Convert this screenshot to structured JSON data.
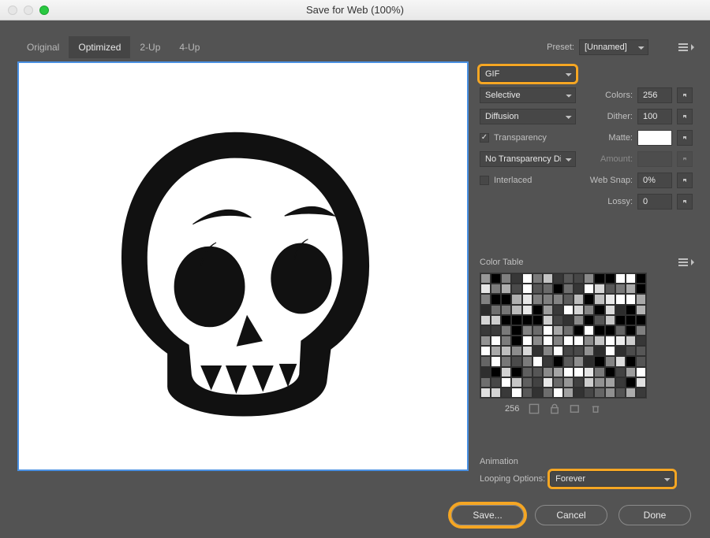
{
  "window": {
    "title": "Save for Web (100%)"
  },
  "tabs": [
    "Original",
    "Optimized",
    "2-Up",
    "4-Up"
  ],
  "active_tab": 1,
  "preset": {
    "label": "Preset:",
    "value": "[Unnamed]"
  },
  "format": {
    "value": "GIF"
  },
  "reduction": {
    "value": "Selective"
  },
  "colors": {
    "label": "Colors:",
    "value": "256"
  },
  "dither_algo": {
    "value": "Diffusion"
  },
  "dither": {
    "label": "Dither:",
    "value": "100%"
  },
  "transparency": {
    "label": "Transparency",
    "checked": true
  },
  "matte": {
    "label": "Matte:"
  },
  "trans_dither": {
    "value": "No Transparency Dit..."
  },
  "amount": {
    "label": "Amount:"
  },
  "interlaced": {
    "label": "Interlaced",
    "checked": false
  },
  "websnap": {
    "label": "Web Snap:",
    "value": "0%"
  },
  "lossy": {
    "label": "Lossy:",
    "value": "0"
  },
  "color_table": {
    "label": "Color Table",
    "count": "256"
  },
  "animation": {
    "label": "Animation",
    "looping_label": "Looping Options:",
    "looping_value": "Forever"
  },
  "buttons": {
    "save": "Save...",
    "cancel": "Cancel",
    "done": "Done"
  }
}
